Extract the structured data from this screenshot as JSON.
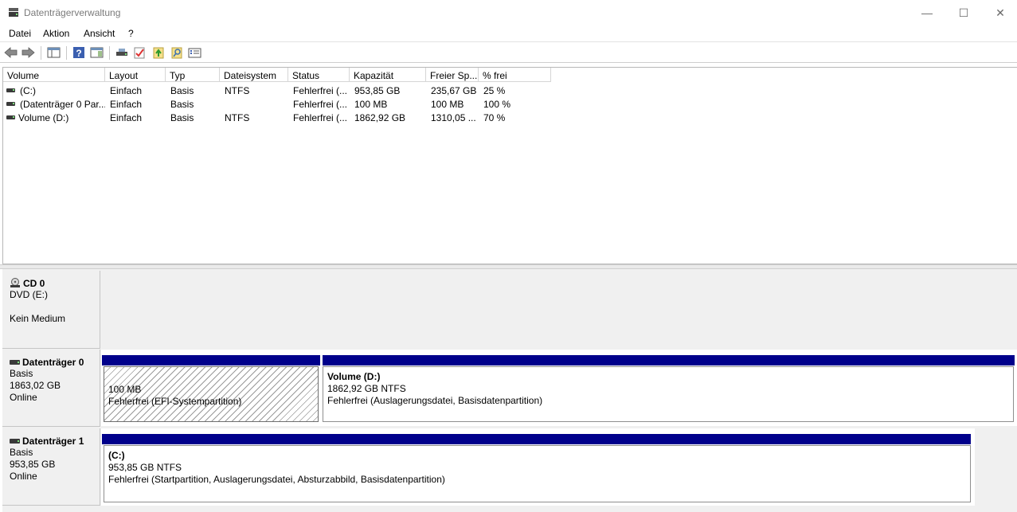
{
  "window": {
    "title": "Datenträgerverwaltung",
    "controls": {
      "minimize": "—",
      "maximize": "☐",
      "close": "✕"
    }
  },
  "menu": {
    "items": [
      "Datei",
      "Aktion",
      "Ansicht",
      "?"
    ]
  },
  "toolbar": {
    "buttons": [
      "back-icon",
      "forward-icon",
      "show-hide-console-tree-icon",
      "help-icon",
      "show-action-pane-icon",
      "connect-virtual-disk-icon",
      "check-icon",
      "import-icon",
      "search-icon",
      "properties-icon"
    ]
  },
  "volume_list": {
    "columns": [
      "Volume",
      "Layout",
      "Typ",
      "Dateisystem",
      "Status",
      "Kapazität",
      "Freier Sp...",
      "% frei"
    ],
    "rows": [
      {
        "volume": "(C:)",
        "layout": "Einfach",
        "typ": "Basis",
        "dateisystem": "NTFS",
        "status": "Fehlerfrei (...",
        "kapazitaet": "953,85 GB",
        "frei": "235,67 GB",
        "prozent": "25 %"
      },
      {
        "volume": "(Datenträger 0 Par...",
        "layout": "Einfach",
        "typ": "Basis",
        "dateisystem": "",
        "status": "Fehlerfrei (...",
        "kapazitaet": "100 MB",
        "frei": "100 MB",
        "prozent": "100 %"
      },
      {
        "volume": "Volume (D:)",
        "layout": "Einfach",
        "typ": "Basis",
        "dateisystem": "NTFS",
        "status": "Fehlerfrei (...",
        "kapazitaet": "1862,92 GB",
        "frei": "1310,05 ...",
        "prozent": "70 %"
      }
    ]
  },
  "disks": [
    {
      "name": "CD 0",
      "icon": "cd-drive-icon",
      "lines": [
        "DVD (E:)",
        "",
        "Kein Medium"
      ],
      "partitions": []
    },
    {
      "name": "Datenträger 0",
      "icon": "disk-icon",
      "lines": [
        "Basis",
        "1863,02 GB",
        "Online"
      ],
      "partitions": [
        {
          "name": "",
          "size": "100 MB",
          "status": "Fehlerfrei (EFI-Systempartition)",
          "selected": true
        },
        {
          "name": "Volume  (D:)",
          "size": "1862,92 GB NTFS",
          "status": "Fehlerfrei (Auslagerungsdatei, Basisdatenpartition)",
          "selected": false
        }
      ]
    },
    {
      "name": "Datenträger 1",
      "icon": "disk-icon",
      "lines": [
        "Basis",
        "953,85 GB",
        "Online"
      ],
      "partitions": [
        {
          "name": " (C:)",
          "size": "953,85 GB NTFS",
          "status": "Fehlerfrei (Startpartition, Auslagerungsdatei, Absturzabbild, Basisdatenpartition)",
          "selected": false
        }
      ]
    }
  ],
  "colors": {
    "partition_bar": "#00008b",
    "accent_text": "#000000"
  }
}
